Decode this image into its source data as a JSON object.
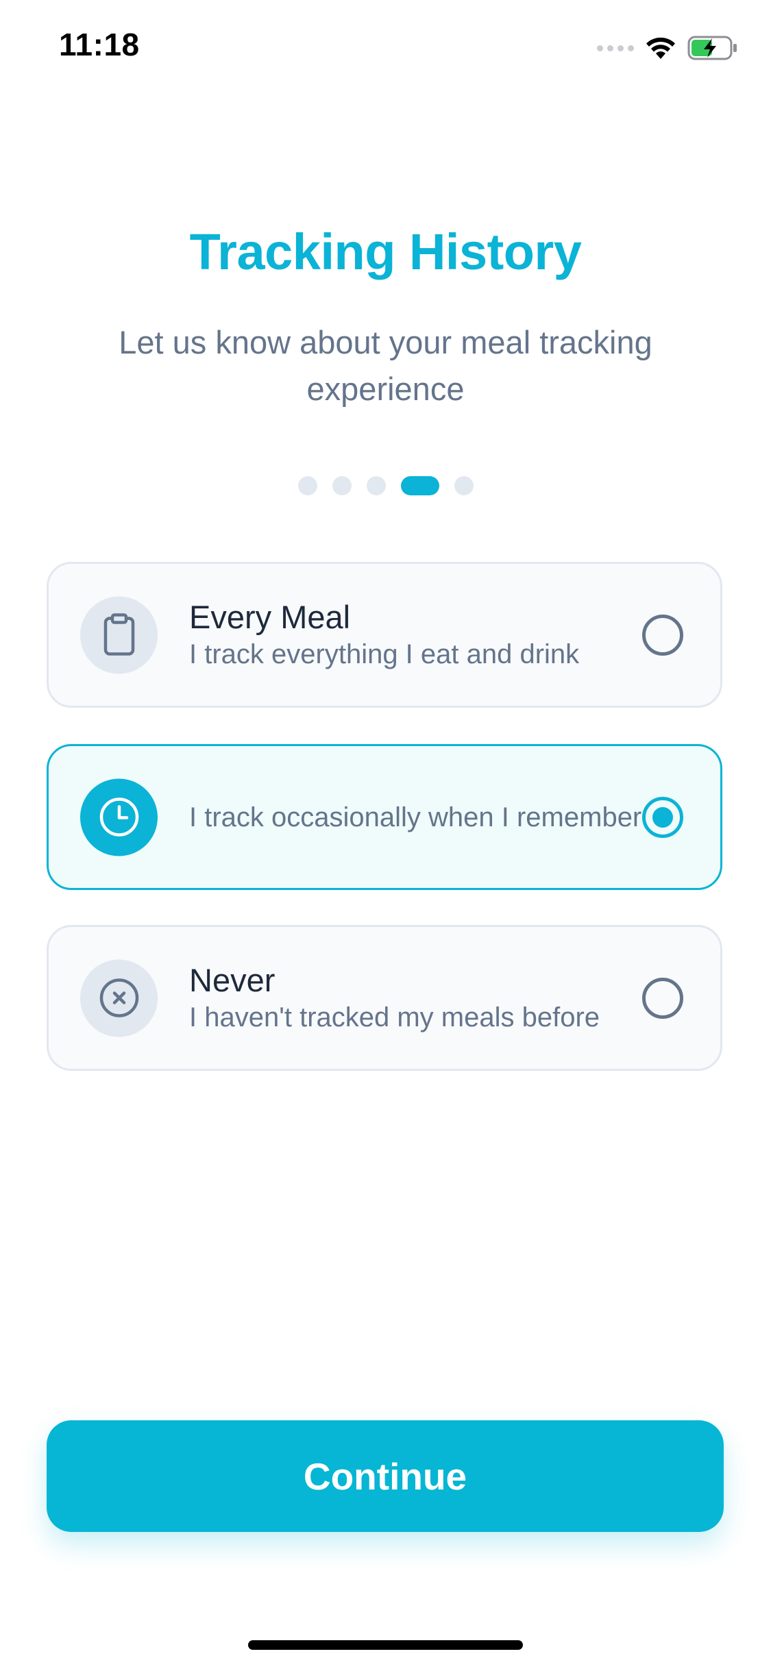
{
  "status_bar": {
    "time": "11:18",
    "wifi_icon": "wifi-icon",
    "battery_icon": "battery-charging-icon",
    "battery_color": "#34c759"
  },
  "header": {
    "title": "Tracking History",
    "subtitle": "Let us know about your meal tracking experience"
  },
  "pager": {
    "total": 5,
    "active_index": 3
  },
  "options": [
    {
      "title": "Every Meal",
      "description": "I track everything I eat and drink",
      "icon": "clipboard-icon",
      "selected": false
    },
    {
      "title": "",
      "description": "I track occasionally when I remember",
      "icon": "clock-icon",
      "selected": true
    },
    {
      "title": "Never",
      "description": "I haven't tracked my meals before",
      "icon": "x-circle-icon",
      "selected": false
    }
  ],
  "continue_button": {
    "label": "Continue"
  },
  "colors": {
    "accent": "#0bb3d6",
    "text_primary": "#1e293b",
    "text_secondary": "#64748b",
    "card_border": "#e2e8f0",
    "selected_bg": "#effcfb"
  }
}
